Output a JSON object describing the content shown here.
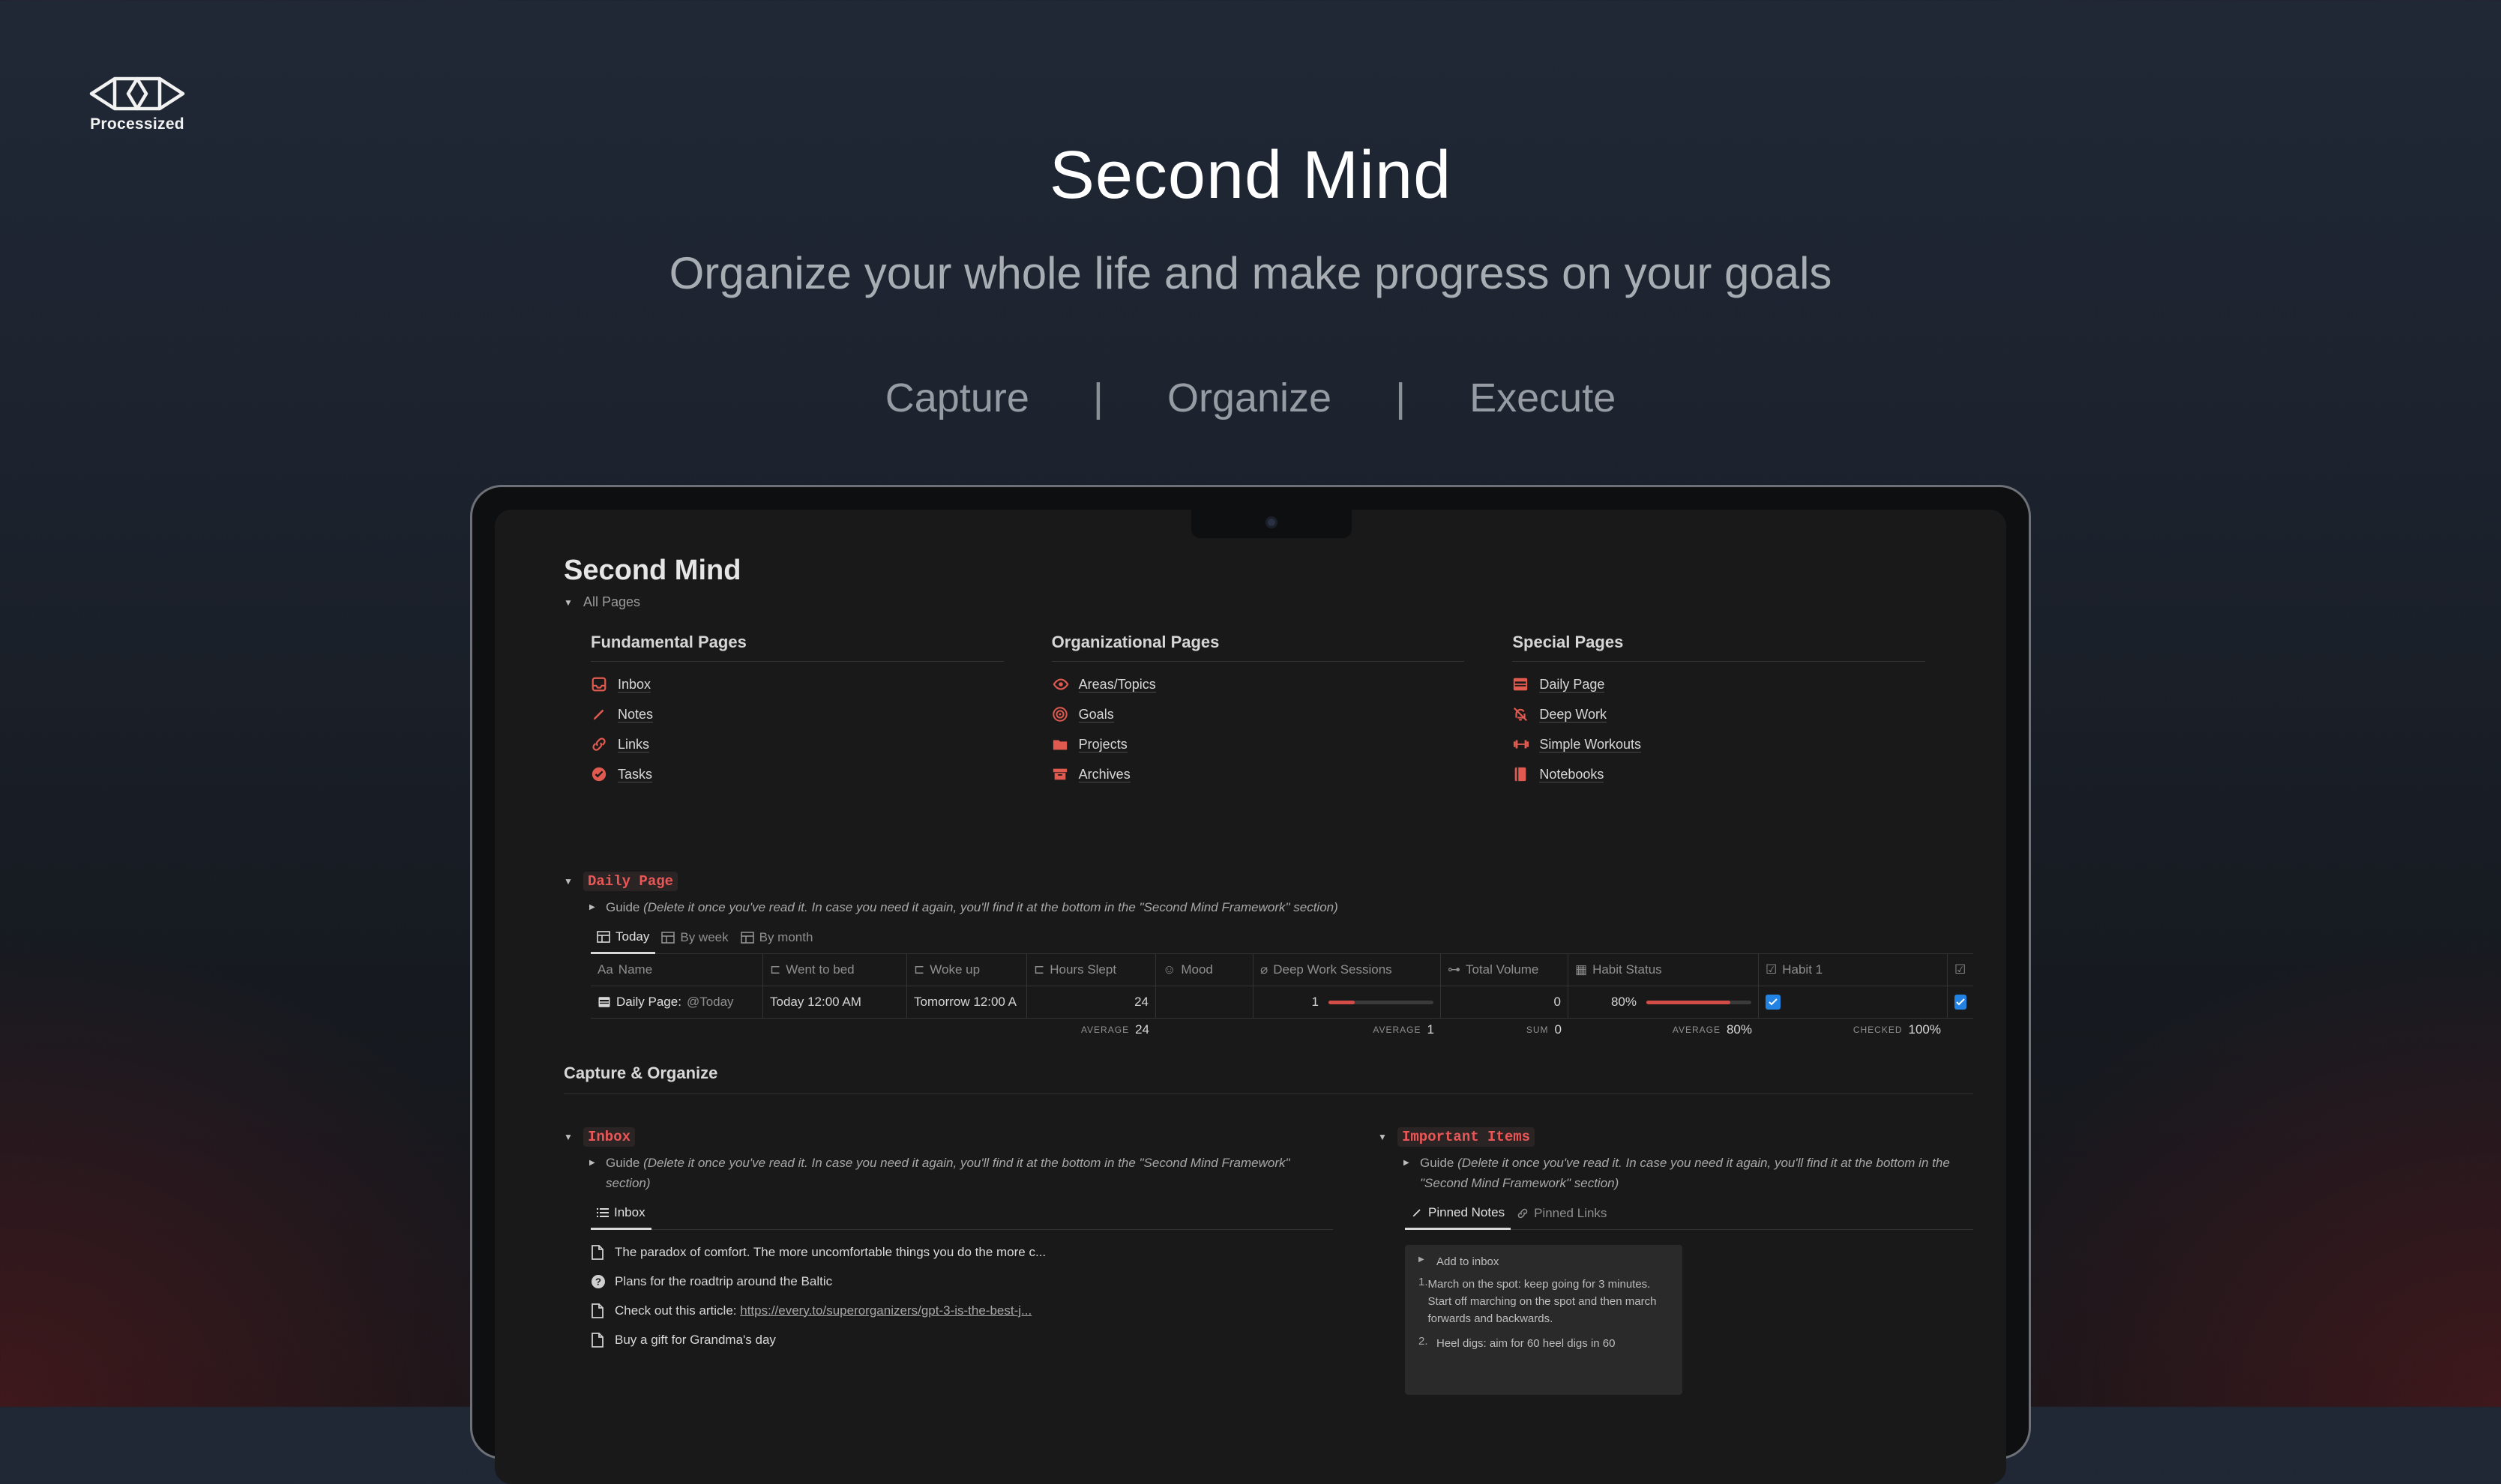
{
  "brand": {
    "name": "Processized",
    "icon": "prism-logo"
  },
  "hero": {
    "title": "Second Mind",
    "subtitle": "Organize your whole life and make progress on your goals",
    "nav": [
      "Capture",
      "Organize",
      "Execute"
    ],
    "separator": "|"
  },
  "notion": {
    "page_title": "Second Mind",
    "all_pages": "All Pages",
    "columns": [
      {
        "title": "Fundamental Pages",
        "items": [
          {
            "label": "Inbox",
            "icon": "inbox-icon"
          },
          {
            "label": "Notes",
            "icon": "pencil-icon"
          },
          {
            "label": "Links",
            "icon": "link-icon"
          },
          {
            "label": "Tasks",
            "icon": "checkmark-circle-icon"
          }
        ]
      },
      {
        "title": "Organizational Pages",
        "items": [
          {
            "label": "Areas/Topics",
            "icon": "eye-icon"
          },
          {
            "label": "Goals",
            "icon": "target-icon"
          },
          {
            "label": "Projects",
            "icon": "folder-icon"
          },
          {
            "label": "Archives",
            "icon": "archive-icon"
          }
        ]
      },
      {
        "title": "Special Pages",
        "items": [
          {
            "label": "Daily Page",
            "icon": "calendar-icon"
          },
          {
            "label": "Deep Work",
            "icon": "bell-off-icon"
          },
          {
            "label": "Simple Workouts",
            "icon": "dumbbell-icon"
          },
          {
            "label": "Notebooks",
            "icon": "notebook-icon"
          }
        ]
      }
    ],
    "daily": {
      "title": "Daily Page",
      "guide_label": "Guide",
      "guide_text": "(Delete it once you've read it. In case you need it again, you'll find it at the bottom in the \"Second Mind Framework\" section)",
      "tabs": [
        "Today",
        "By week",
        "By month"
      ],
      "headers": [
        "Name",
        "Went to bed",
        "Woke up",
        "Hours Slept",
        "Mood",
        "Deep Work Sessions",
        "Total Volume",
        "Habit Status",
        "Habit 1",
        ""
      ],
      "header_prefix": "Aa",
      "row": {
        "name": "Daily Page:",
        "mention": "@Today",
        "went_to_bed": "Today 12:00 AM",
        "woke_up": "Tomorrow 12:00 A",
        "hours_slept": "24",
        "deep_work": "1",
        "deep_work_fraction": 0.25,
        "total_volume": "0",
        "habit_status": "80%",
        "habit_status_fraction": 0.8
      },
      "calc": {
        "hours_key": "AVERAGE",
        "hours_val": "24",
        "deep_key": "AVERAGE",
        "deep_val": "1",
        "vol_key": "SUM",
        "vol_val": "0",
        "habit_key": "AVERAGE",
        "habit_val": "80%",
        "checked_key": "CHECKED",
        "checked_val": "100%"
      }
    },
    "capture_heading": "Capture & Organize",
    "inbox": {
      "title": "Inbox",
      "guide_label": "Guide",
      "guide_text": "(Delete it once you've read it. In case you need it again, you'll find it at the bottom in the \"Second Mind Framework\" section)",
      "tab": "Inbox",
      "items": [
        {
          "text": "The paradox of comfort. The more uncomfortable things you do the more c...",
          "icon": "document-icon"
        },
        {
          "text": "Plans for the roadtrip around the Baltic",
          "icon": "question-circle-icon"
        },
        {
          "text": "Check out this article: ",
          "link": "https://every.to/superorganizers/gpt-3-is-the-best-j...",
          "icon": "document-icon"
        },
        {
          "text": "Buy a gift for Grandma's day",
          "icon": "document-icon"
        }
      ]
    },
    "important": {
      "title": "Important Items",
      "guide_label": "Guide",
      "guide_text": "(Delete it once you've read it. In case you need it again, you'll find it at the bottom in the \"Second Mind Framework\" section)",
      "tabs": [
        "Pinned Notes",
        "Pinned Links"
      ],
      "callout": {
        "toggle": "Add to inbox",
        "steps": [
          "March on the spot: keep going for 3 minutes. Start off marching on the spot and then march forwards and backwards.",
          "Heel digs: aim for 60 heel digs in 60"
        ]
      }
    }
  }
}
